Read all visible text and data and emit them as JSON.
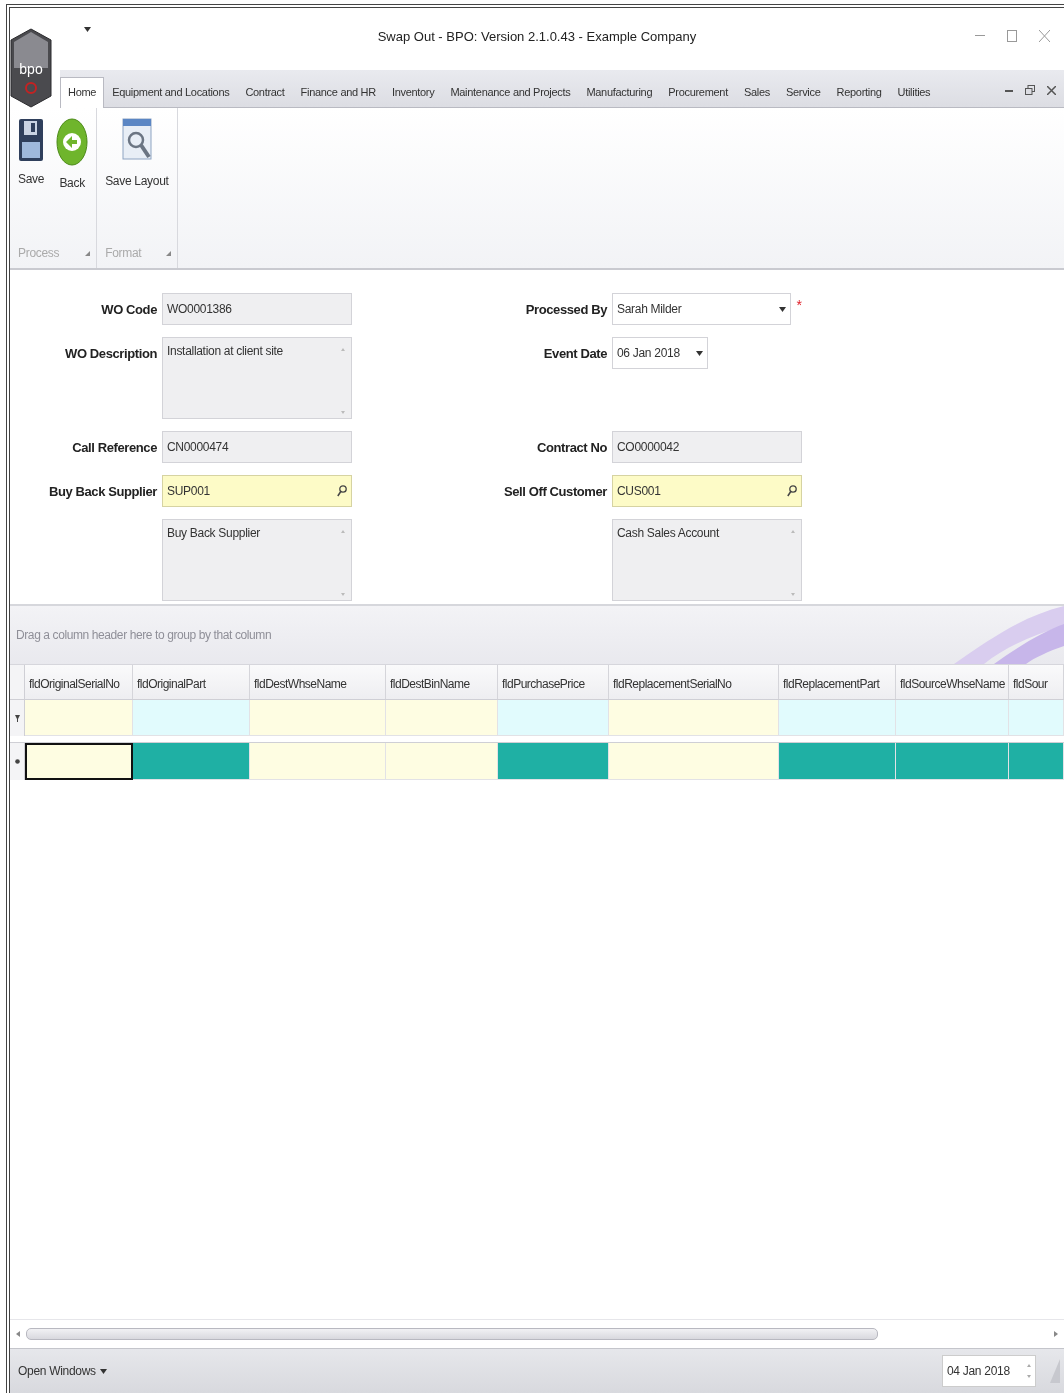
{
  "window": {
    "logo_text": "bpo",
    "title": "Swap Out - BPO: Version 2.1.0.43 - Example Company"
  },
  "tabs": [
    {
      "label": "Home",
      "selected": true
    },
    {
      "label": "Equipment and Locations",
      "selected": false
    },
    {
      "label": "Contract",
      "selected": false
    },
    {
      "label": "Finance and HR",
      "selected": false
    },
    {
      "label": "Inventory",
      "selected": false
    },
    {
      "label": "Maintenance and Projects",
      "selected": false
    },
    {
      "label": "Manufacturing",
      "selected": false
    },
    {
      "label": "Procurement",
      "selected": false
    },
    {
      "label": "Sales",
      "selected": false
    },
    {
      "label": "Service",
      "selected": false
    },
    {
      "label": "Reporting",
      "selected": false
    },
    {
      "label": "Utilities",
      "selected": false
    }
  ],
  "ribbon": {
    "groups": [
      {
        "label": "Process",
        "buttons": [
          "Save",
          "Back"
        ]
      },
      {
        "label": "Format",
        "buttons": [
          "Save Layout"
        ]
      }
    ]
  },
  "form": {
    "rows": [
      {
        "left": {
          "label": "WO Code",
          "value": "WO0001386",
          "kind": "text"
        },
        "right": {
          "label": "Processed By",
          "value": "Sarah Milder",
          "kind": "dropdown",
          "required_mark": "*"
        }
      },
      {
        "left": {
          "label": "WO Description",
          "value": "Installation at client site",
          "kind": "memo"
        },
        "right": {
          "label": "Event Date",
          "value": "06 Jan 2018",
          "kind": "date"
        }
      },
      {
        "left": {
          "label": "Call Reference",
          "value": "CN0000474",
          "kind": "text"
        },
        "right": {
          "label": "Contract No",
          "value": "CO0000042",
          "kind": "text"
        }
      },
      {
        "left": {
          "label": "Buy Back Supplier",
          "value": "SUP001",
          "kind": "lookup"
        },
        "right": {
          "label": "Sell Off Customer",
          "value": "CUS001",
          "kind": "lookup"
        }
      },
      {
        "left": {
          "value": "Buy Back Supplier",
          "kind": "memo"
        },
        "right": {
          "value": "Cash Sales Account",
          "kind": "memo"
        }
      }
    ]
  },
  "grid": {
    "group_hint": "Drag a column header here to group by that column",
    "columns": [
      {
        "header": "fldOriginalSerialNo",
        "editable": true,
        "focused": true
      },
      {
        "header": "fldOriginalPart",
        "editable": false,
        "focused": false
      },
      {
        "header": "fldDestWhseName",
        "editable": true,
        "focused": false
      },
      {
        "header": "fldDestBinName",
        "editable": true,
        "focused": false
      },
      {
        "header": "fldPurchasePrice",
        "editable": false,
        "focused": false
      },
      {
        "header": "fldReplacementSerialNo",
        "editable": true,
        "focused": false
      },
      {
        "header": "fldReplacementPart",
        "editable": false,
        "focused": false
      },
      {
        "header": "fldSourceWhseName",
        "editable": false,
        "focused": false
      },
      {
        "header": "fldSour",
        "editable": false,
        "focused": false
      }
    ]
  },
  "status_bar": {
    "open_windows": "Open Windows",
    "date": "04 Jan 2018"
  }
}
